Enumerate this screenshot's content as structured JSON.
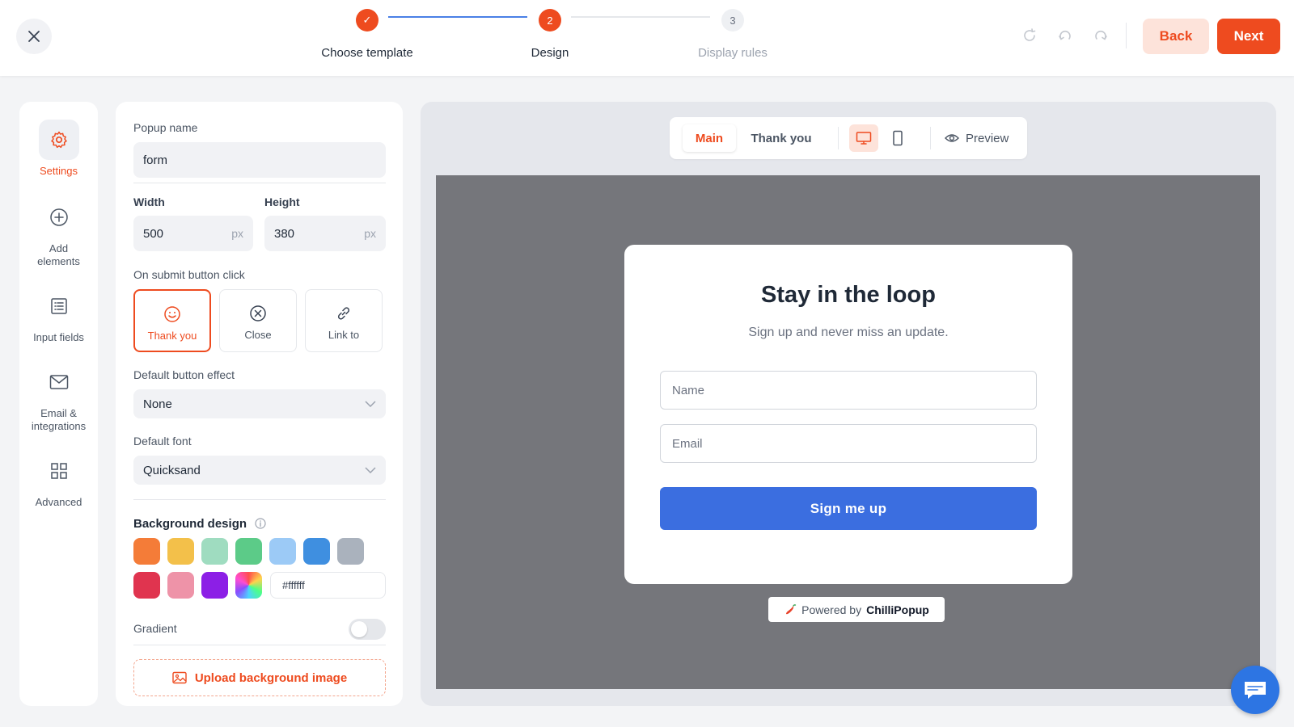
{
  "colors": {
    "accent": "#ee4b1f",
    "accent_soft": "#fde3da",
    "submit_blue": "#3b6ee0",
    "stage_bg": "#75767b"
  },
  "header": {
    "steps": [
      {
        "number": "✓",
        "label": "Choose template",
        "state": "done"
      },
      {
        "number": "2",
        "label": "Design",
        "state": "active"
      },
      {
        "number": "3",
        "label": "Display rules",
        "state": "todo"
      }
    ],
    "back_label": "Back",
    "next_label": "Next"
  },
  "rail": {
    "items": [
      {
        "label": "Settings",
        "icon": "gear-icon"
      },
      {
        "label": "Add elements",
        "icon": "plus-circle-icon"
      },
      {
        "label": "Input fields",
        "icon": "list-icon"
      },
      {
        "label": "Email & integrations",
        "icon": "envelope-icon"
      },
      {
        "label": "Advanced",
        "icon": "grid-icon"
      }
    ]
  },
  "settings": {
    "popup_name_label": "Popup name",
    "popup_name_value": "form",
    "width_label": "Width",
    "width_value": "500",
    "height_label": "Height",
    "height_value": "380",
    "unit": "px",
    "submit_action_label": "On submit button click",
    "submit_actions": [
      {
        "label": "Thank you",
        "icon": "smile-icon",
        "selected": true
      },
      {
        "label": "Close",
        "icon": "close-circle-icon",
        "selected": false
      },
      {
        "label": "Link to",
        "icon": "link-icon",
        "selected": false
      }
    ],
    "button_effect_label": "Default button effect",
    "button_effect_value": "None",
    "font_label": "Default font",
    "font_value": "Quicksand",
    "background_label": "Background design",
    "swatches": [
      "#f47c38",
      "#f3c04a",
      "#9fdcc0",
      "#5ccb88",
      "#9ccaf6",
      "#3f8fe0",
      "#aab2bd",
      "#e0344f",
      "#ee93a8",
      "#8c1fe6"
    ],
    "hex_value": "#ffffff",
    "gradient_label": "Gradient",
    "gradient_on": false,
    "upload_label": "Upload background image"
  },
  "canvas": {
    "tabs": [
      {
        "label": "Main"
      },
      {
        "label": "Thank you"
      }
    ],
    "preview_label": "Preview",
    "popup": {
      "title": "Stay in the loop",
      "subtitle": "Sign up and never miss an update.",
      "name_placeholder": "Name",
      "email_placeholder": "Email",
      "submit_label": "Sign me up"
    },
    "powered_prefix": "Powered by",
    "powered_brand": "ChilliPopup"
  }
}
